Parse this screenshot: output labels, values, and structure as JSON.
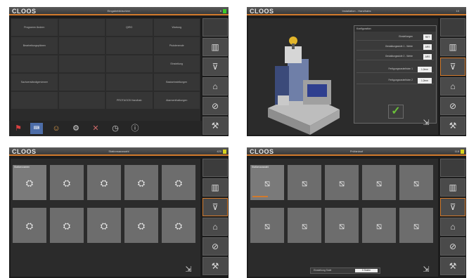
{
  "colors": {
    "accent": "#d27a2c",
    "status_green": "#3ccc2a",
    "status_yellow": "#d8d41e",
    "check_green": "#6abf3a"
  },
  "logo": "CLOOS",
  "sidebar_icons": [
    "grid-icon",
    "menu-down-icon",
    "home-icon",
    "stop-circles-icon",
    "robot-arm-icon"
  ],
  "screen1": {
    "title": "Eingabebildschirm",
    "status_num": "8",
    "status_color": "#3ccc2a",
    "menu": [
      [
        "Programm Ändern",
        "",
        "QIRO",
        "Wartung"
      ],
      [
        "Bearbeitungsplänen",
        "",
        "",
        "Pistolenende"
      ],
      [
        "",
        "",
        "",
        "Einstellung"
      ],
      [
        "Sachverständigerviewer",
        "",
        "",
        "Basiseinstellungen"
      ],
      [
        "",
        "",
        "PROTAOCB Handhab",
        "Alarmenthaltungen"
      ]
    ],
    "bottom_icons": [
      "flag-icon",
      "keyboard-icon",
      "user-icon",
      "tools-icon",
      "wrench-cross-icon",
      "timer-icon",
      "info-icon"
    ]
  },
  "screen2": {
    "title": "Installation - Handhabs",
    "status_num": "10",
    "panel_title": "Konfiguration",
    "rows": [
      {
        "label": "Einstellungen",
        "value": "RET"
      },
      {
        "label": "Gestaltungsstufe 1 - Werte",
        "value": "ARS"
      },
      {
        "label": "Gestaltungsstufe 2 - Werte",
        "value": "ARS"
      },
      {
        "label": "Fertigungsrasterlisten 1",
        "value": "1.2mm"
      },
      {
        "label": "Fertigungsrasterlisten 2",
        "value": "1.2mm"
      }
    ],
    "confirm": "✓"
  },
  "screen3": {
    "title": "Stationsauswahl",
    "status_num": "420",
    "status_color": "#d8d41e",
    "first_tile_label": "Stationsnamen",
    "tile_glyph": "⛭",
    "tiles": 10
  },
  "screen4": {
    "title": "Prüfanlauf",
    "status_num": "118",
    "status_color": "#d8d41e",
    "first_tile_label": "Stationsauswahl",
    "tile_glyph": "⧅",
    "tiles": 10,
    "first_tile_progress": 0.7,
    "footer_label": "Einstellung Stufe",
    "footer_value": "0 Stufen"
  },
  "footer_icons": [
    "exit-icon",
    "robot-arm-icon"
  ]
}
